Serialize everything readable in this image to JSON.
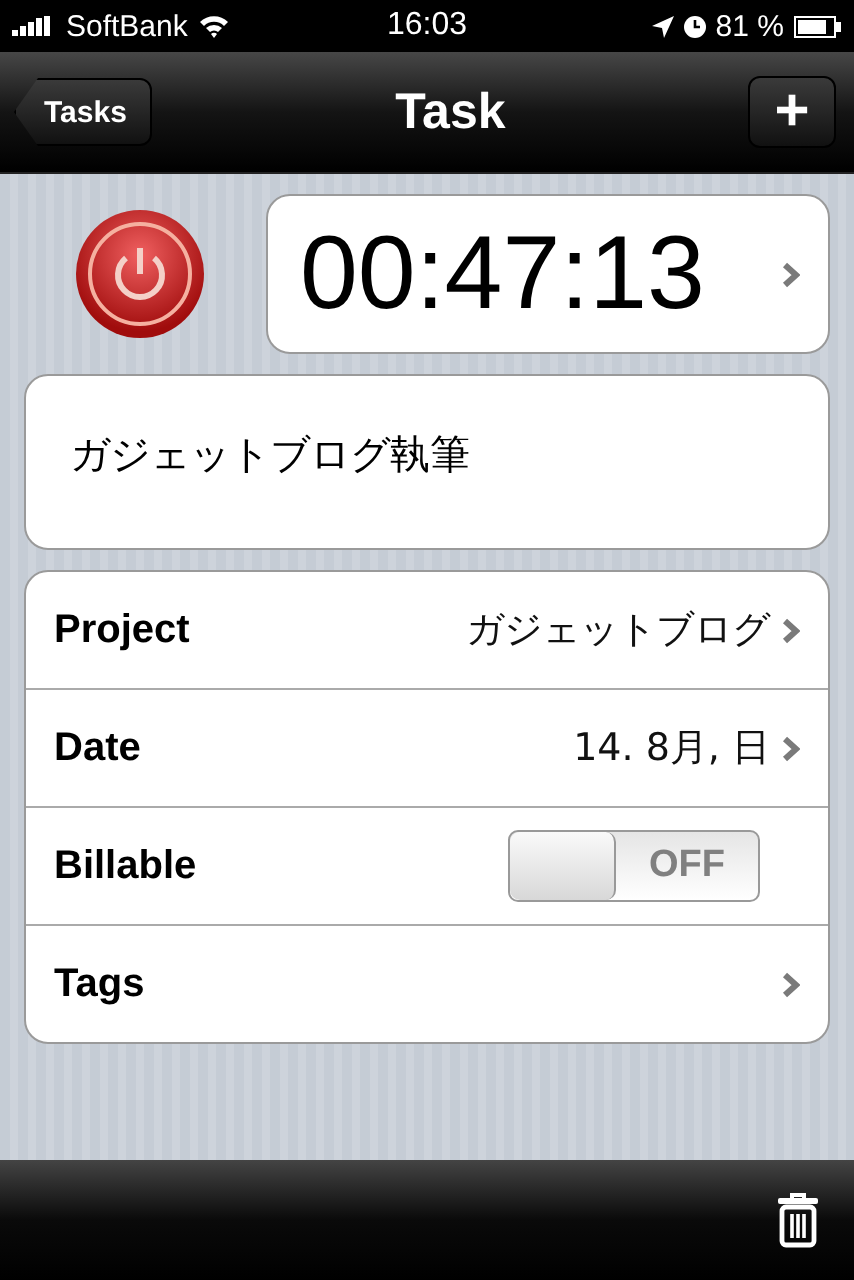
{
  "status_bar": {
    "carrier": "SoftBank",
    "time": "16:03",
    "battery": "81 %"
  },
  "nav": {
    "back": "Tasks",
    "title": "Task",
    "add": "+"
  },
  "timer": {
    "running": false,
    "elapsed": "00:47:13"
  },
  "task_name": "ガジェットブログ執筆",
  "rows": [
    {
      "kind": "link",
      "label": "Project",
      "value": "ガジェットブログ"
    },
    {
      "kind": "link",
      "label": "Date",
      "value": "14. 8月, 日"
    },
    {
      "kind": "toggle",
      "label": "Billable",
      "on": false,
      "off_label": "OFF"
    },
    {
      "kind": "link",
      "label": "Tags"
    }
  ]
}
